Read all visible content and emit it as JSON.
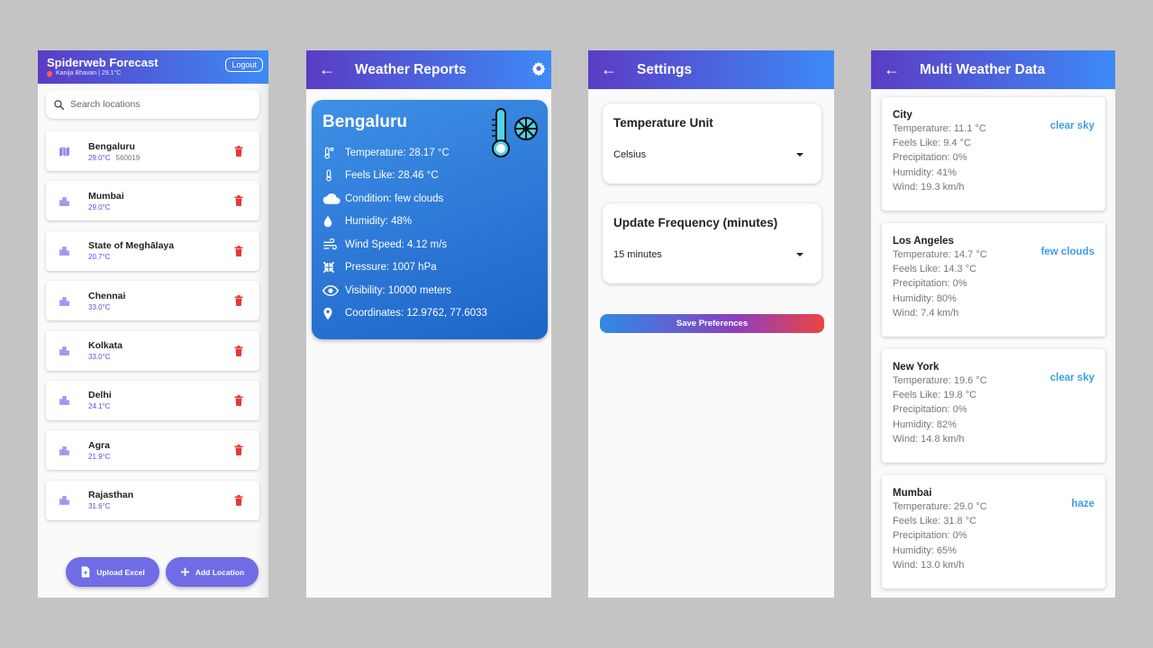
{
  "screen1": {
    "title": "Spiderweb Forecast",
    "subtitle": "Kanija Bhavan | 29.1°C",
    "logout_label": "Logout",
    "search_placeholder": "Search locations",
    "locations": [
      {
        "name": "Bengaluru",
        "temp": "29.0°C",
        "pincode": "560019",
        "icon": "map-icon"
      },
      {
        "name": "Mumbai",
        "temp": "29.0°C",
        "icon": "city-icon"
      },
      {
        "name": "State of Meghālaya",
        "temp": "20.7°C",
        "icon": "city-icon"
      },
      {
        "name": "Chennai",
        "temp": "33.0°C",
        "icon": "city-icon"
      },
      {
        "name": "Kolkata",
        "temp": "33.0°C",
        "icon": "city-icon"
      },
      {
        "name": "Delhi",
        "temp": "24.1°C",
        "icon": "city-icon"
      },
      {
        "name": "Agra",
        "temp": "21.9°C",
        "icon": "city-icon"
      },
      {
        "name": "Rajasthan",
        "temp": "31.6°C",
        "icon": "city-icon"
      }
    ],
    "upload_label": "Upload Excel",
    "add_label": "Add Location"
  },
  "screen2": {
    "title": "Weather Reports",
    "city": "Bengaluru",
    "rows": [
      {
        "icon": "thermometer-icon",
        "text": "Temperature: 28.17 °C"
      },
      {
        "icon": "feels-like-icon",
        "text": "Feels Like: 28.46 °C"
      },
      {
        "icon": "cloud-icon",
        "text": "Condition: few clouds"
      },
      {
        "icon": "humidity-icon",
        "text": "Humidity: 48%"
      },
      {
        "icon": "wind-icon",
        "text": "Wind Speed: 4.12 m/s"
      },
      {
        "icon": "pressure-icon",
        "text": "Pressure: 1007 hPa"
      },
      {
        "icon": "eye-icon",
        "text": "Visibility: 10000 meters"
      },
      {
        "icon": "location-pin-icon",
        "text": "Coordinates: 12.9762, 77.6033"
      }
    ]
  },
  "screen3": {
    "title": "Settings",
    "unit_title": "Temperature Unit",
    "unit_value": "Celsius",
    "freq_title": "Update Frequency (minutes)",
    "freq_value": "15 minutes",
    "save_label": "Save Preferences"
  },
  "screen4": {
    "title": "Multi Weather Data",
    "cards": [
      {
        "city": "City",
        "condition": "clear sky",
        "temperature": "Temperature: 11.1 °C",
        "feels": "Feels Like: 9.4 °C",
        "precip": "Precipitation: 0%",
        "humidity": "Humidity: 41%",
        "wind": "Wind: 19.3 km/h"
      },
      {
        "city": "Los Angeles",
        "condition": "few clouds",
        "temperature": "Temperature: 14.7 °C",
        "feels": "Feels Like: 14.3 °C",
        "precip": "Precipitation: 0%",
        "humidity": "Humidity: 80%",
        "wind": "Wind: 7.4 km/h"
      },
      {
        "city": "New York",
        "condition": "clear sky",
        "temperature": "Temperature: 19.6 °C",
        "feels": "Feels Like: 19.8 °C",
        "precip": "Precipitation: 0%",
        "humidity": "Humidity: 82%",
        "wind": "Wind: 14.8 km/h"
      },
      {
        "city": "Mumbai",
        "condition": "haze",
        "temperature": "Temperature: 29.0 °C",
        "feels": "Feels Like: 31.8 °C",
        "precip": "Precipitation: 0%",
        "humidity": "Humidity: 65%",
        "wind": "Wind: 13.0 km/h"
      }
    ]
  },
  "colors": {
    "accent": "#6f6ce6",
    "delete": "#e53935",
    "condition": "#3c9ee6"
  }
}
